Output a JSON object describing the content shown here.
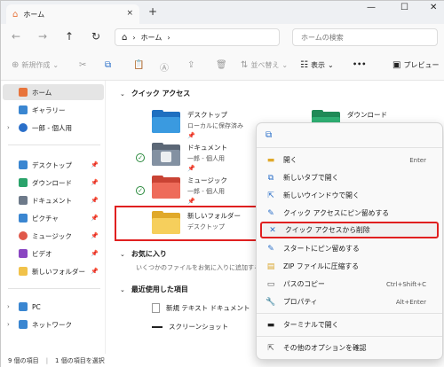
{
  "window": {
    "tab_title": "ホーム",
    "close_tab": "×",
    "new_tab": "+",
    "minimize": "—",
    "maximize": "☐",
    "close": "✕"
  },
  "nav": {
    "back": "←",
    "forward": "→",
    "up": "↑",
    "refresh": "↻",
    "breadcrumb": "ホーム",
    "search_placeholder": "ホームの検索"
  },
  "toolbar": {
    "new": "新規作成",
    "sort": "並べ替え",
    "view": "表示",
    "more": "•••",
    "preview": "プレビュー"
  },
  "sidebar": {
    "items": [
      {
        "label": "ホーム",
        "icon": "home-icon",
        "color": "#e8743b",
        "selected": true
      },
      {
        "label": "ギャラリー",
        "icon": "gallery-icon",
        "color": "#3a86d1"
      },
      {
        "label": "一郎 - 個人用",
        "icon": "cloud-icon",
        "color": "#2a6fc9",
        "chevron": true
      },
      {
        "label": "デスクトップ",
        "icon": "desktop-icon",
        "color": "#3a86d1",
        "pin": true
      },
      {
        "label": "ダウンロード",
        "icon": "download-icon",
        "color": "#2aa36b",
        "pin": true
      },
      {
        "label": "ドキュメント",
        "icon": "documents-icon",
        "color": "#6d7a8a",
        "pin": true
      },
      {
        "label": "ピクチャ",
        "icon": "pictures-icon",
        "color": "#3a86d1",
        "pin": true
      },
      {
        "label": "ミュージック",
        "icon": "music-icon",
        "color": "#e0584a",
        "pin": true
      },
      {
        "label": "ビデオ",
        "icon": "videos-icon",
        "color": "#8a46c2",
        "pin": true
      },
      {
        "label": "新しいフォルダー",
        "icon": "folder-icon",
        "color": "#f1c24a",
        "pin": true
      },
      {
        "label": "PC",
        "icon": "pc-icon",
        "color": "#3a86d1",
        "chevron": true
      },
      {
        "label": "ネットワーク",
        "icon": "network-icon",
        "color": "#3a86d1",
        "chevron": true
      }
    ]
  },
  "main": {
    "quick_access": "クイック アクセス",
    "favorites": "お気に入り",
    "favorites_empty": "いくつかのファイルをお気に入りに追加すると、ここに表示されます。",
    "recent": "最近使用した項目",
    "folders": [
      {
        "name": "デスクトップ",
        "sub": "ローカルに保存済み",
        "pin": "📌"
      },
      {
        "name": "ドキュメント",
        "sub": "一郎 - 個人用",
        "pin": "📌"
      },
      {
        "name": "ミュージック",
        "sub": "一郎 - 個人用",
        "pin": "📌"
      },
      {
        "name": "新しいフォルダー",
        "sub": "デスクトップ"
      },
      {
        "name": "ダウンロード",
        "sub": ""
      }
    ],
    "recent_items": [
      "新規 テキスト ドキュメント",
      "スクリーンショット"
    ]
  },
  "context_menu": {
    "items": [
      {
        "label": "開く",
        "shortcut": "Enter",
        "icon": "folder-open-icon"
      },
      {
        "label": "新しいタブで開く",
        "icon": "new-tab-icon"
      },
      {
        "label": "新しいウインドウで開く",
        "icon": "new-window-icon"
      },
      {
        "label": "クイック アクセスにピン留めする",
        "icon": "pin-icon"
      },
      {
        "label": "クイック アクセスから削除",
        "icon": "remove-icon",
        "highlighted": true
      },
      {
        "label": "スタートにピン留めする",
        "icon": "pin-start-icon"
      },
      {
        "label": "ZIP ファイルに圧縮する",
        "icon": "zip-icon"
      },
      {
        "label": "パスのコピー",
        "shortcut": "Ctrl+Shift+C",
        "icon": "copy-path-icon"
      },
      {
        "label": "プロパティ",
        "shortcut": "Alt+Enter",
        "icon": "properties-icon"
      },
      {
        "label": "ターミナルで開く",
        "icon": "terminal-icon"
      },
      {
        "label": "その他のオプションを確認",
        "icon": "more-options-icon"
      }
    ]
  },
  "status": {
    "count": "9 個の項目",
    "selected": "1 個の項目を選択"
  }
}
